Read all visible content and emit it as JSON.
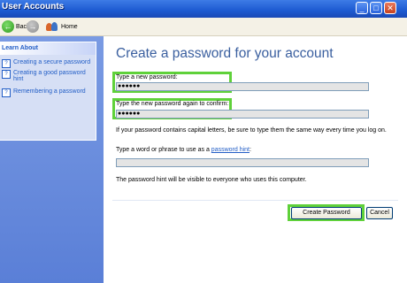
{
  "window": {
    "title": "User Accounts"
  },
  "titlebar": {
    "minimize_glyph": "_",
    "maximize_glyph": "□",
    "close_glyph": "✕"
  },
  "nav": {
    "back_label": "Back",
    "home_label": "Home",
    "back_icon": "back-arrow-icon",
    "forward_icon": "forward-arrow-icon",
    "home_icon": "home-icon"
  },
  "sidebar": {
    "heading": "Learn About",
    "links": [
      {
        "label": "Creating a secure password"
      },
      {
        "label": "Creating a good password hint"
      },
      {
        "label": "Remembering a password"
      }
    ]
  },
  "main": {
    "heading": "Create a password for your account",
    "new_password": {
      "label": "Type a new password:",
      "value": "●●●●●●"
    },
    "confirm_password": {
      "label": "Type the new password again to confirm:",
      "value": "●●●●●●"
    },
    "caps_note": "If your password contains capital letters, be sure to type them the same way every time you log on.",
    "hint_prompt_prefix": "Type a word or phrase to use as a ",
    "hint_link": "password hint",
    "hint_prompt_suffix": ":",
    "hint_value": "",
    "hint_visibility_note": "The password hint will be visible to everyone who uses this computer.",
    "create_button": "Create Password",
    "cancel_button": "Cancel"
  },
  "colors": {
    "highlight": "#5fd13a",
    "heading": "#3a5f9f",
    "link": "#215dc6"
  }
}
